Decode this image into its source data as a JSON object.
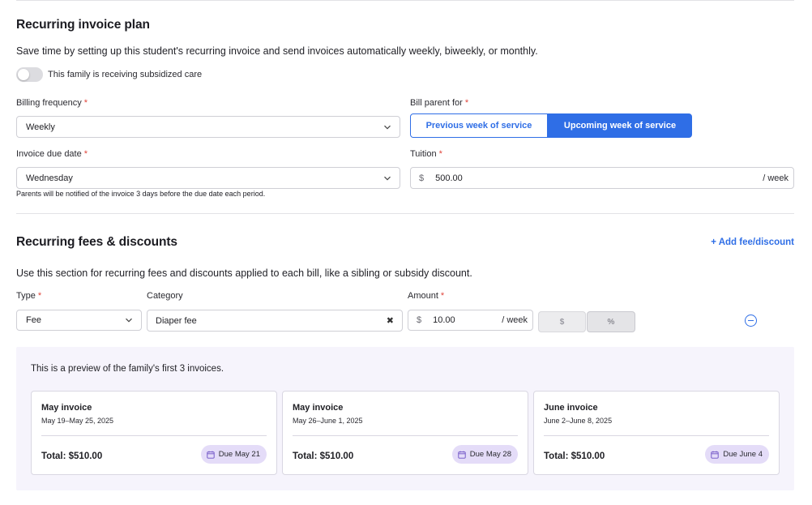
{
  "plan": {
    "title": "Recurring invoice plan",
    "description": "Save time by setting up this student's recurring invoice and send invoices automatically weekly, biweekly, or monthly.",
    "subsidized_toggle": {
      "label": "This family is receiving subsidized care",
      "on": false
    },
    "billing_frequency": {
      "label": "Billing frequency",
      "required_mark": "*",
      "value": "Weekly"
    },
    "bill_parent_for": {
      "label": "Bill parent for",
      "required_mark": "*",
      "options": [
        "Previous week of service",
        "Upcoming week of service"
      ],
      "selected": "Upcoming week of service"
    },
    "invoice_due_date": {
      "label": "Invoice due date",
      "required_mark": "*",
      "value": "Wednesday",
      "hint": "Parents will be notified of the invoice 3 days before the due date each period."
    },
    "tuition": {
      "label": "Tuition",
      "required_mark": "*",
      "currency": "$",
      "value": "500.00",
      "unit": "/ week"
    }
  },
  "fees": {
    "title": "Recurring fees & discounts",
    "add_link": "+ Add fee/discount",
    "description": "Use this section for recurring fees and discounts applied to each bill, like a sibling or subsidy discount.",
    "type": {
      "label": "Type",
      "required_mark": "*",
      "value": "Fee"
    },
    "category": {
      "label": "Category",
      "value": "Diaper fee",
      "clear_glyph": "✖"
    },
    "amount": {
      "label": "Amount",
      "required_mark": "*",
      "currency": "$",
      "value": "10.00",
      "unit": "/ week"
    },
    "mode_buttons": {
      "dollar": "$",
      "percent": "%"
    }
  },
  "preview": {
    "title": "This is a preview of the family's first 3 invoices.",
    "cards": [
      {
        "title": "May invoice",
        "range": "May 19–May 25, 2025",
        "total": "Total: $510.00",
        "due": "Due May 21"
      },
      {
        "title": "May invoice",
        "range": "May 26–June 1, 2025",
        "total": "Total: $510.00",
        "due": "Due May 28"
      },
      {
        "title": "June invoice",
        "range": "June 2–June 8, 2025",
        "total": "Total: $510.00",
        "due": "Due June 4"
      }
    ]
  },
  "colors": {
    "accent": "#2f6ee6",
    "required": "#e0453b",
    "preview_bg": "#f6f4fc",
    "badge_bg": "#e4dcf8"
  },
  "icons": {
    "select_arrow": "chevron-down-icon",
    "remove": "minus-circle-icon",
    "due": "calendar-icon"
  }
}
